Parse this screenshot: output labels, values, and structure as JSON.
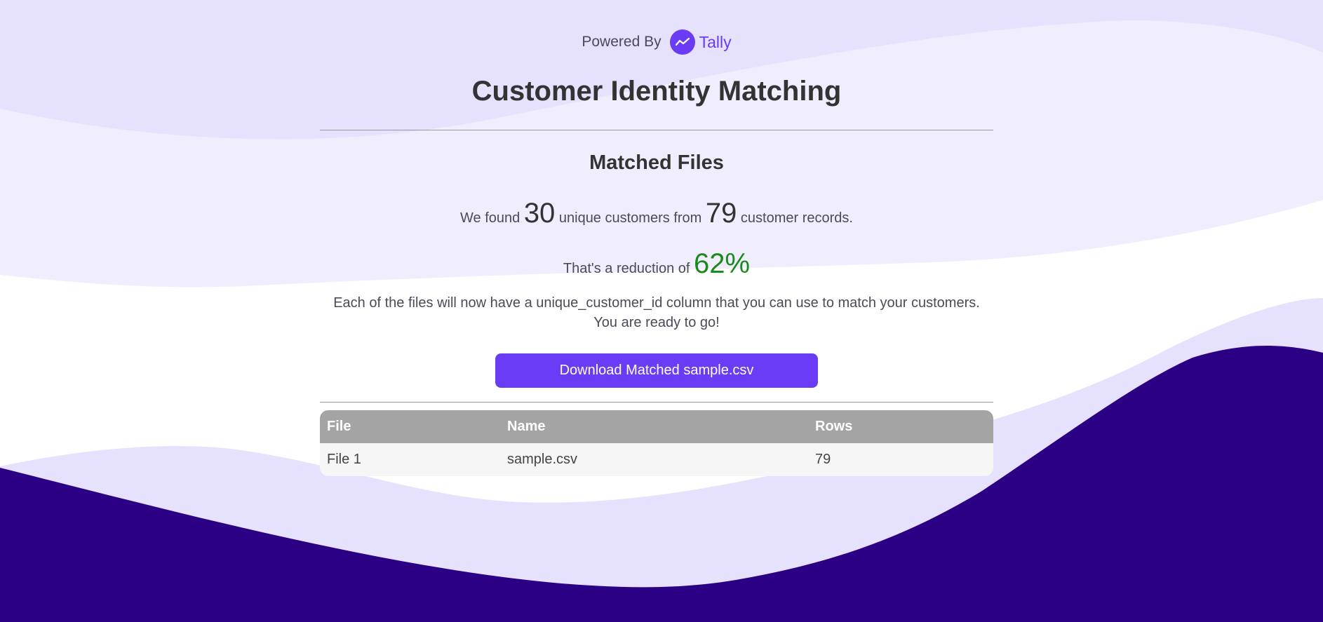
{
  "colors": {
    "accent": "#6a3cf5",
    "success": "#1a8a1a",
    "wave_light": "#e6e1fd",
    "wave_lighter": "#f0eefe",
    "wave_dark": "#2b0085",
    "table_header": "#a4a4a4"
  },
  "header": {
    "powered_by_label": "Powered By",
    "logo_icon": "tally-chart-icon",
    "brand_name": "Tally",
    "title": "Customer Identity Matching"
  },
  "summary": {
    "heading": "Matched Files",
    "found_prefix": "We found",
    "unique_customers": "30",
    "found_middle": "unique customers from",
    "customer_records": "79",
    "found_suffix": "customer records.",
    "reduction_prefix": "That's a reduction of",
    "reduction_percent": "62%",
    "description_line1": "Each of the files will now have a unique_customer_id column that you can use to match your customers.",
    "description_line2": "You are ready to go!"
  },
  "download_button": {
    "label": "Download Matched sample.csv"
  },
  "files_table": {
    "columns": [
      "File",
      "Name",
      "Rows"
    ],
    "rows": [
      [
        "File 1",
        "sample.csv",
        "79"
      ]
    ]
  }
}
